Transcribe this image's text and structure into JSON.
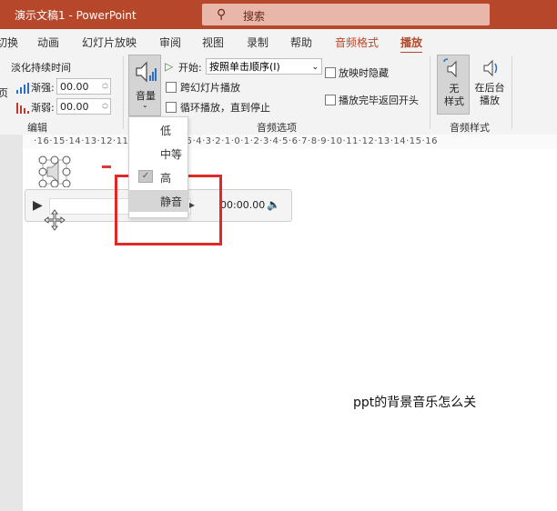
{
  "window": {
    "title": "演示文稿1  -  PowerPoint"
  },
  "search": {
    "icon": "search-icon",
    "placeholder": "搜索"
  },
  "tabs": [
    "切换",
    "动画",
    "幻灯片放映",
    "审阅",
    "视图",
    "录制",
    "帮助",
    "音频格式",
    "播放"
  ],
  "active_tab": "播放",
  "edit_group": {
    "fade_label": "淡化持续时间",
    "fade_in_label": "渐强:",
    "fade_in_value": "00.00",
    "fade_out_label": "渐弱:",
    "fade_out_value": "00.00",
    "group_label": "编辑",
    "left_clip": "页"
  },
  "audio_options": {
    "volume_label": "音量",
    "start_label": "开始:",
    "start_value": "按照单击顺序(I)",
    "cross_slides": "跨幻灯片播放",
    "loop": "循环播放，直到停止",
    "hide_during_show": "放映时隐藏",
    "rewind": "播放完毕返回开头",
    "group_label": "音频选项"
  },
  "audio_style": {
    "no_style": "无\n样式",
    "background": "在后台\n播放",
    "group_label": "音频样式"
  },
  "ruler": {
    "labels": "·16·15·14·13·12·11·10·9·8·7·6·5·4·3·2·1·0·1·2·3·4·5·6·7·8·9·10·11·12·13·14·15·16"
  },
  "volume_menu": {
    "items": [
      "低",
      "中等",
      "高",
      "静音"
    ],
    "checked": "高",
    "hover": "静音"
  },
  "player": {
    "time": "00:00.00"
  },
  "caption": "ppt的背景音乐怎么关",
  "colors": {
    "accent": "#b7472a",
    "highlight_box": "#e02828"
  }
}
